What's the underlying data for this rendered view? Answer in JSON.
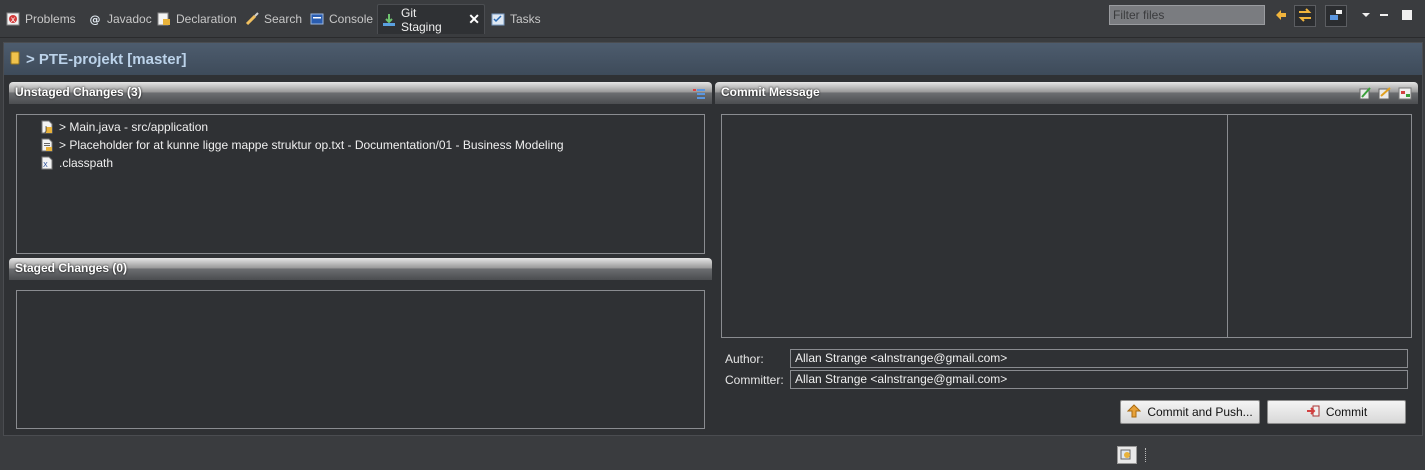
{
  "tabs": [
    {
      "label": "Problems",
      "icon": "problems-icon",
      "active": false
    },
    {
      "label": "Javadoc",
      "icon": "javadoc-icon",
      "active": false
    },
    {
      "label": "Declaration",
      "icon": "declaration-icon",
      "active": false
    },
    {
      "label": "Search",
      "icon": "search-icon",
      "active": false
    },
    {
      "label": "Console",
      "icon": "console-icon",
      "active": false
    },
    {
      "label": "Git Staging",
      "icon": "git-staging-icon",
      "active": true
    },
    {
      "label": "Tasks",
      "icon": "tasks-icon",
      "active": false
    }
  ],
  "filter": {
    "placeholder": "Filter files"
  },
  "repo": {
    "title": "> PTE-projekt [master]"
  },
  "unstaged": {
    "title": "Unstaged Changes (3)",
    "items": [
      {
        "label": "> Main.java - src/application",
        "icon": "java-file-icon"
      },
      {
        "label": "> Placeholder for at kunne ligge mappe struktur op.txt - Documentation/01 - Business Modeling",
        "icon": "text-file-icon"
      },
      {
        "label": ".classpath",
        "icon": "xml-file-icon"
      }
    ]
  },
  "staged": {
    "title": "Staged Changes (0)"
  },
  "commit": {
    "title": "Commit Message",
    "message": "",
    "author_label": "Author:",
    "author_value": "Allan Strange <alnstrange@gmail.com>",
    "committer_label": "Committer:",
    "committer_value": "Allan Strange <alnstrange@gmail.com>",
    "commit_push_label": "Commit and Push...",
    "commit_label": "Commit"
  },
  "colors": {
    "repo_bar": "#4d5c6e",
    "accent": "#bcd3ea",
    "panel_bg": "#2f3134"
  }
}
